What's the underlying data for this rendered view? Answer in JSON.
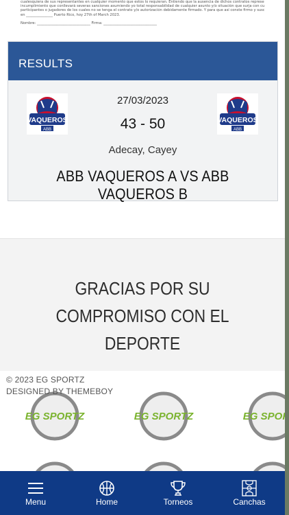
{
  "document": {
    "lines": [
      "cualesquiera de sus representantes en cualquier momento que estos lo requieran. Entiendo que la ausencia de dichos contratos representa un",
      "incumplimiento que conllevará severas sanciones asumiendo yo total responsabilidad de cualquier asunto y/o situación que surja con cualesquiera",
      "participantes o jugadores de los cuales no se tenga el contrato y/o autorización debidamente firmado. Y para que así conste firmo y suscribo la presente",
      "en _______________ Puerto Rico, hoy 27th of March 2023."
    ],
    "signature_line": "Nombre: ______________________________     Firma: ______________________________"
  },
  "results": {
    "header": "RESULTS",
    "date": "27/03/2023",
    "score": "43 - 50",
    "venue": "Adecay, Cayey",
    "matchup": "ABB VAQUEROS A VS ABB VAQUEROS B",
    "logo_text": "VAQUEROS",
    "logo_sub": "ABB"
  },
  "thanks": {
    "text": "GRACIAS POR SU COMPROMISO CON EL DEPORTE"
  },
  "footer": {
    "copyright": "© 2023 EG SPORTZ",
    "designed_by": "DESIGNED BY THEMEBOY",
    "tile_text": "EG SPORTZ"
  },
  "nav": {
    "items": [
      {
        "label": "Menu",
        "icon": "menu-icon"
      },
      {
        "label": "Home",
        "icon": "basketball-icon"
      },
      {
        "label": "Torneos",
        "icon": "trophy-icon"
      },
      {
        "label": "Canchas",
        "icon": "court-icon"
      }
    ]
  },
  "colors": {
    "header_blue": "#2b5797",
    "nav_blue": "#0f3a86",
    "logo_red": "#c8102e",
    "logo_navy": "#1f3b8a",
    "tile_green": "#7ab32e"
  }
}
